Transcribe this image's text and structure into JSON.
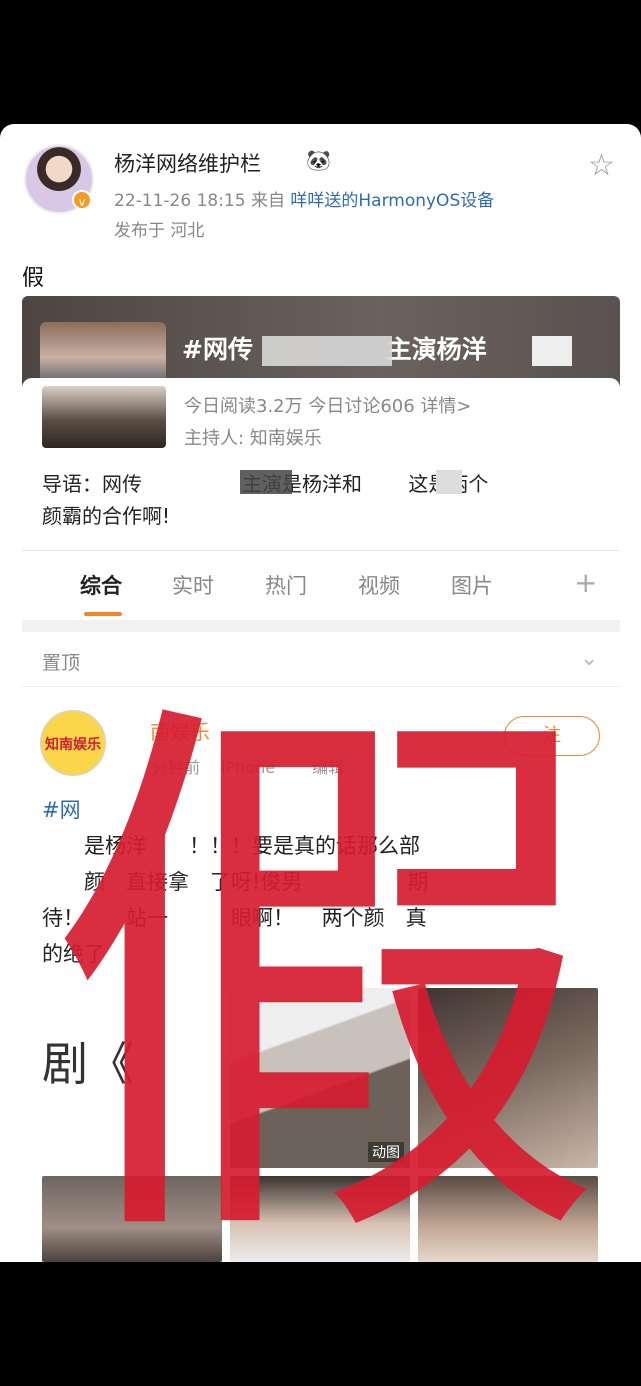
{
  "header": {
    "username": "杨洋网络维护栏",
    "panda": "🐼",
    "time": "22-11-26 18:15",
    "from_label": "来自",
    "source": "咩咩送的HarmonyOS设备",
    "location": "发布于 河北",
    "star_icon": "☆"
  },
  "post": {
    "text": "假"
  },
  "topic": {
    "title": "#网传　　　　　 主演杨洋　　#",
    "stats": "今日阅读3.2万  今日讨论606  详情>",
    "host": "主持人: 知南娱乐",
    "guide_line1": "导语：网传　　　　　主演是杨洋和　　 这是两个",
    "guide_line2": "颜霸的合作啊!"
  },
  "tabs": [
    "综合",
    "实时",
    "热门",
    "视频",
    "图片"
  ],
  "tab_plus": "+",
  "pinned": {
    "label": "置顶",
    "chevron": "⌄"
  },
  "inner_post": {
    "avatar_text": "知南娱乐",
    "name": "南娱乐",
    "meta": "分钟前　 iPhone　　 编辑",
    "follow": "注",
    "tag_line": "#网",
    "line1": "　　是杨洋　　！！！要是真的话那么部",
    "line2": "　　颜　直接拿　了呀!俊男　　　　　期",
    "line3": "待！　　站一　　　眼啊！　 两个颜　真",
    "line4": "的绝了"
  },
  "images": {
    "img1_text": "剧《",
    "img2_label": "动图"
  },
  "stamp": "假",
  "colors": {
    "accent": "#f0872d",
    "link": "#2f6bb5",
    "stamp": "#d61c30"
  }
}
